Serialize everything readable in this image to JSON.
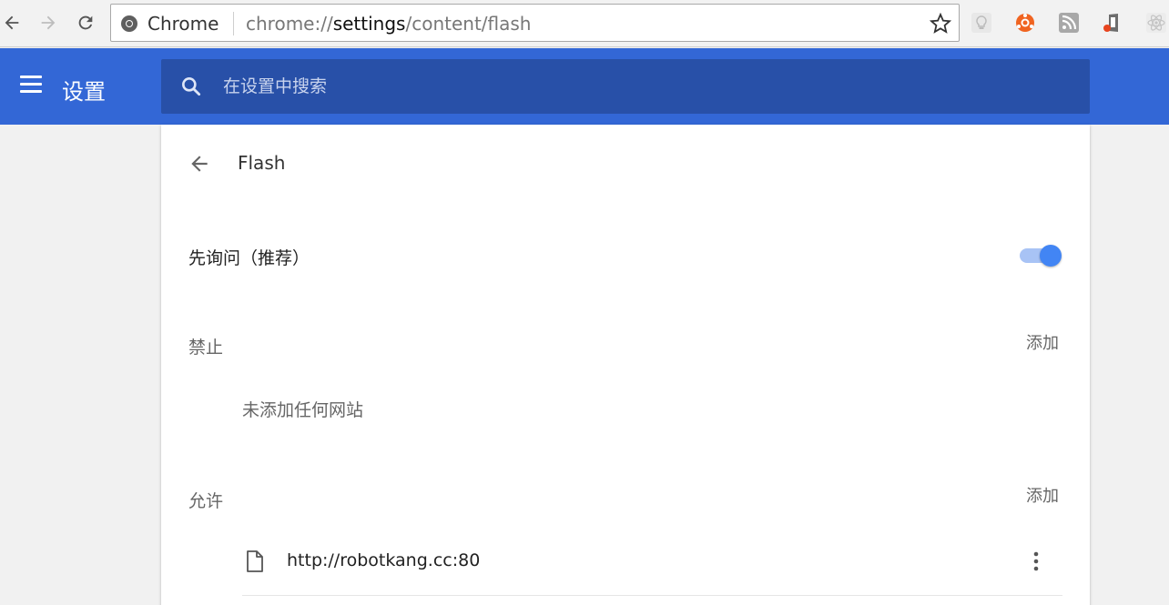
{
  "browser": {
    "omnibox_chip": "Chrome",
    "url_scheme": "chrome://",
    "url_host": "settings",
    "url_path": "/content/flash"
  },
  "header": {
    "title": "设置",
    "search_placeholder": "在设置中搜索"
  },
  "page": {
    "title": "Flash",
    "ask_label": "先询问（推荐）",
    "ask_enabled": true
  },
  "blocked": {
    "label": "禁止",
    "add_label": "添加",
    "empty_text": "未添加任何网站"
  },
  "allowed": {
    "label": "允许",
    "add_label": "添加",
    "sites": [
      {
        "url": "http://robotkang.cc:80"
      }
    ]
  },
  "colors": {
    "header_blue": "#3367d6",
    "search_blue": "#2850a8",
    "toggle_on": "#4285f4"
  }
}
